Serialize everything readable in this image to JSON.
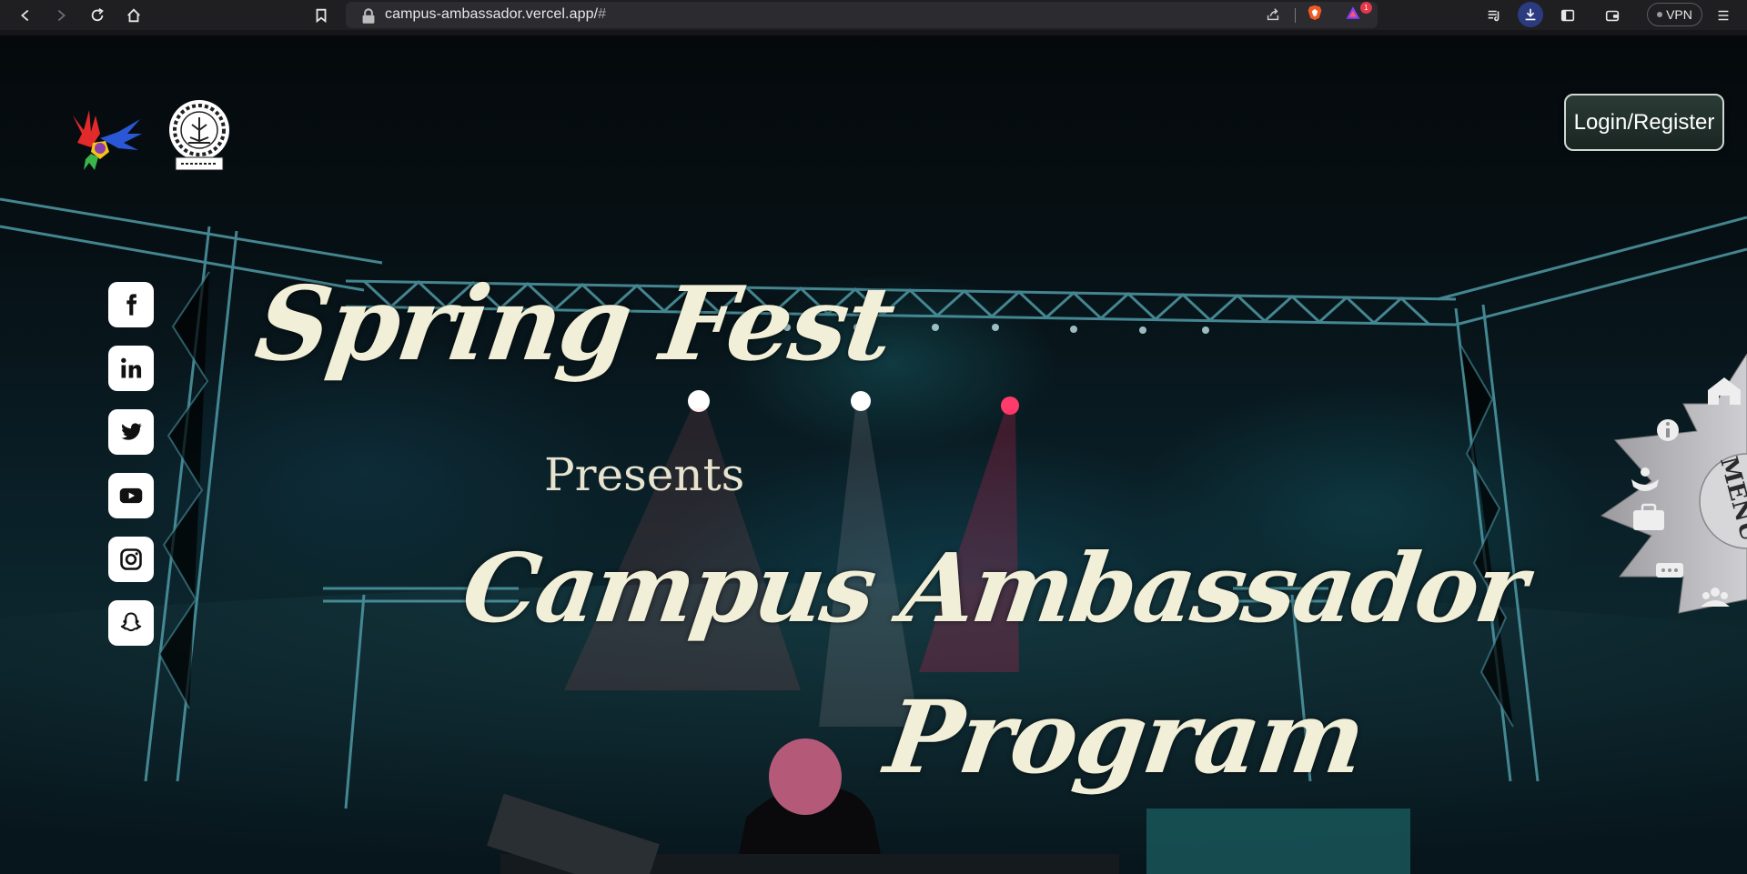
{
  "browser": {
    "url_host": "campus-ambassador.vercel.app/",
    "url_hash": "#",
    "vpn_label": "VPN",
    "notification_count": "1"
  },
  "header": {
    "login_label": "Login/Register"
  },
  "hero": {
    "title_line1": "Spring Fest",
    "presents": "Presents",
    "title_line2": "Campus Ambassador",
    "title_line3": "Program"
  },
  "social": [
    "facebook-icon",
    "linkedin-icon",
    "twitter-icon",
    "youtube-icon",
    "instagram-icon",
    "snapchat-icon"
  ],
  "menu": {
    "label": "MENU",
    "items": [
      "home-icon",
      "info-icon",
      "hands-heart-icon",
      "briefcase-icon",
      "chat-icon",
      "team-icon"
    ]
  },
  "colors": {
    "title": "#f1efd8",
    "stage_teal": "#1e8f99",
    "menu_fan": "#b9b9bd"
  }
}
